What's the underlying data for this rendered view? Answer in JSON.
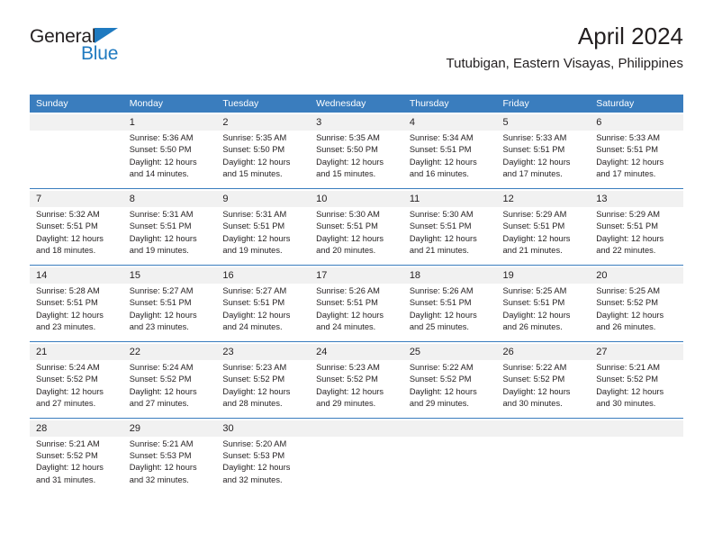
{
  "brand": {
    "name_part1": "General",
    "name_part2": "Blue",
    "colors": {
      "dark": "#231f20",
      "blue": "#1f7ac0"
    }
  },
  "header": {
    "title": "April 2024",
    "subtitle": "Tutubigan, Eastern Visayas, Philippines"
  },
  "calendar": {
    "accent_color": "#3a7dbe",
    "daynum_background": "#f1f1f1",
    "weekday_headers": [
      "Sunday",
      "Monday",
      "Tuesday",
      "Wednesday",
      "Thursday",
      "Friday",
      "Saturday"
    ],
    "weeks": [
      [
        {
          "day": "",
          "sunrise": "",
          "sunset": "",
          "daylight_line1": "",
          "daylight_line2": ""
        },
        {
          "day": "1",
          "sunrise": "Sunrise: 5:36 AM",
          "sunset": "Sunset: 5:50 PM",
          "daylight_line1": "Daylight: 12 hours",
          "daylight_line2": "and 14 minutes."
        },
        {
          "day": "2",
          "sunrise": "Sunrise: 5:35 AM",
          "sunset": "Sunset: 5:50 PM",
          "daylight_line1": "Daylight: 12 hours",
          "daylight_line2": "and 15 minutes."
        },
        {
          "day": "3",
          "sunrise": "Sunrise: 5:35 AM",
          "sunset": "Sunset: 5:50 PM",
          "daylight_line1": "Daylight: 12 hours",
          "daylight_line2": "and 15 minutes."
        },
        {
          "day": "4",
          "sunrise": "Sunrise: 5:34 AM",
          "sunset": "Sunset: 5:51 PM",
          "daylight_line1": "Daylight: 12 hours",
          "daylight_line2": "and 16 minutes."
        },
        {
          "day": "5",
          "sunrise": "Sunrise: 5:33 AM",
          "sunset": "Sunset: 5:51 PM",
          "daylight_line1": "Daylight: 12 hours",
          "daylight_line2": "and 17 minutes."
        },
        {
          "day": "6",
          "sunrise": "Sunrise: 5:33 AM",
          "sunset": "Sunset: 5:51 PM",
          "daylight_line1": "Daylight: 12 hours",
          "daylight_line2": "and 17 minutes."
        }
      ],
      [
        {
          "day": "7",
          "sunrise": "Sunrise: 5:32 AM",
          "sunset": "Sunset: 5:51 PM",
          "daylight_line1": "Daylight: 12 hours",
          "daylight_line2": "and 18 minutes."
        },
        {
          "day": "8",
          "sunrise": "Sunrise: 5:31 AM",
          "sunset": "Sunset: 5:51 PM",
          "daylight_line1": "Daylight: 12 hours",
          "daylight_line2": "and 19 minutes."
        },
        {
          "day": "9",
          "sunrise": "Sunrise: 5:31 AM",
          "sunset": "Sunset: 5:51 PM",
          "daylight_line1": "Daylight: 12 hours",
          "daylight_line2": "and 19 minutes."
        },
        {
          "day": "10",
          "sunrise": "Sunrise: 5:30 AM",
          "sunset": "Sunset: 5:51 PM",
          "daylight_line1": "Daylight: 12 hours",
          "daylight_line2": "and 20 minutes."
        },
        {
          "day": "11",
          "sunrise": "Sunrise: 5:30 AM",
          "sunset": "Sunset: 5:51 PM",
          "daylight_line1": "Daylight: 12 hours",
          "daylight_line2": "and 21 minutes."
        },
        {
          "day": "12",
          "sunrise": "Sunrise: 5:29 AM",
          "sunset": "Sunset: 5:51 PM",
          "daylight_line1": "Daylight: 12 hours",
          "daylight_line2": "and 21 minutes."
        },
        {
          "day": "13",
          "sunrise": "Sunrise: 5:29 AM",
          "sunset": "Sunset: 5:51 PM",
          "daylight_line1": "Daylight: 12 hours",
          "daylight_line2": "and 22 minutes."
        }
      ],
      [
        {
          "day": "14",
          "sunrise": "Sunrise: 5:28 AM",
          "sunset": "Sunset: 5:51 PM",
          "daylight_line1": "Daylight: 12 hours",
          "daylight_line2": "and 23 minutes."
        },
        {
          "day": "15",
          "sunrise": "Sunrise: 5:27 AM",
          "sunset": "Sunset: 5:51 PM",
          "daylight_line1": "Daylight: 12 hours",
          "daylight_line2": "and 23 minutes."
        },
        {
          "day": "16",
          "sunrise": "Sunrise: 5:27 AM",
          "sunset": "Sunset: 5:51 PM",
          "daylight_line1": "Daylight: 12 hours",
          "daylight_line2": "and 24 minutes."
        },
        {
          "day": "17",
          "sunrise": "Sunrise: 5:26 AM",
          "sunset": "Sunset: 5:51 PM",
          "daylight_line1": "Daylight: 12 hours",
          "daylight_line2": "and 24 minutes."
        },
        {
          "day": "18",
          "sunrise": "Sunrise: 5:26 AM",
          "sunset": "Sunset: 5:51 PM",
          "daylight_line1": "Daylight: 12 hours",
          "daylight_line2": "and 25 minutes."
        },
        {
          "day": "19",
          "sunrise": "Sunrise: 5:25 AM",
          "sunset": "Sunset: 5:51 PM",
          "daylight_line1": "Daylight: 12 hours",
          "daylight_line2": "and 26 minutes."
        },
        {
          "day": "20",
          "sunrise": "Sunrise: 5:25 AM",
          "sunset": "Sunset: 5:52 PM",
          "daylight_line1": "Daylight: 12 hours",
          "daylight_line2": "and 26 minutes."
        }
      ],
      [
        {
          "day": "21",
          "sunrise": "Sunrise: 5:24 AM",
          "sunset": "Sunset: 5:52 PM",
          "daylight_line1": "Daylight: 12 hours",
          "daylight_line2": "and 27 minutes."
        },
        {
          "day": "22",
          "sunrise": "Sunrise: 5:24 AM",
          "sunset": "Sunset: 5:52 PM",
          "daylight_line1": "Daylight: 12 hours",
          "daylight_line2": "and 27 minutes."
        },
        {
          "day": "23",
          "sunrise": "Sunrise: 5:23 AM",
          "sunset": "Sunset: 5:52 PM",
          "daylight_line1": "Daylight: 12 hours",
          "daylight_line2": "and 28 minutes."
        },
        {
          "day": "24",
          "sunrise": "Sunrise: 5:23 AM",
          "sunset": "Sunset: 5:52 PM",
          "daylight_line1": "Daylight: 12 hours",
          "daylight_line2": "and 29 minutes."
        },
        {
          "day": "25",
          "sunrise": "Sunrise: 5:22 AM",
          "sunset": "Sunset: 5:52 PM",
          "daylight_line1": "Daylight: 12 hours",
          "daylight_line2": "and 29 minutes."
        },
        {
          "day": "26",
          "sunrise": "Sunrise: 5:22 AM",
          "sunset": "Sunset: 5:52 PM",
          "daylight_line1": "Daylight: 12 hours",
          "daylight_line2": "and 30 minutes."
        },
        {
          "day": "27",
          "sunrise": "Sunrise: 5:21 AM",
          "sunset": "Sunset: 5:52 PM",
          "daylight_line1": "Daylight: 12 hours",
          "daylight_line2": "and 30 minutes."
        }
      ],
      [
        {
          "day": "28",
          "sunrise": "Sunrise: 5:21 AM",
          "sunset": "Sunset: 5:52 PM",
          "daylight_line1": "Daylight: 12 hours",
          "daylight_line2": "and 31 minutes."
        },
        {
          "day": "29",
          "sunrise": "Sunrise: 5:21 AM",
          "sunset": "Sunset: 5:53 PM",
          "daylight_line1": "Daylight: 12 hours",
          "daylight_line2": "and 32 minutes."
        },
        {
          "day": "30",
          "sunrise": "Sunrise: 5:20 AM",
          "sunset": "Sunset: 5:53 PM",
          "daylight_line1": "Daylight: 12 hours",
          "daylight_line2": "and 32 minutes."
        },
        {
          "day": "",
          "sunrise": "",
          "sunset": "",
          "daylight_line1": "",
          "daylight_line2": ""
        },
        {
          "day": "",
          "sunrise": "",
          "sunset": "",
          "daylight_line1": "",
          "daylight_line2": ""
        },
        {
          "day": "",
          "sunrise": "",
          "sunset": "",
          "daylight_line1": "",
          "daylight_line2": ""
        },
        {
          "day": "",
          "sunrise": "",
          "sunset": "",
          "daylight_line1": "",
          "daylight_line2": ""
        }
      ]
    ]
  }
}
